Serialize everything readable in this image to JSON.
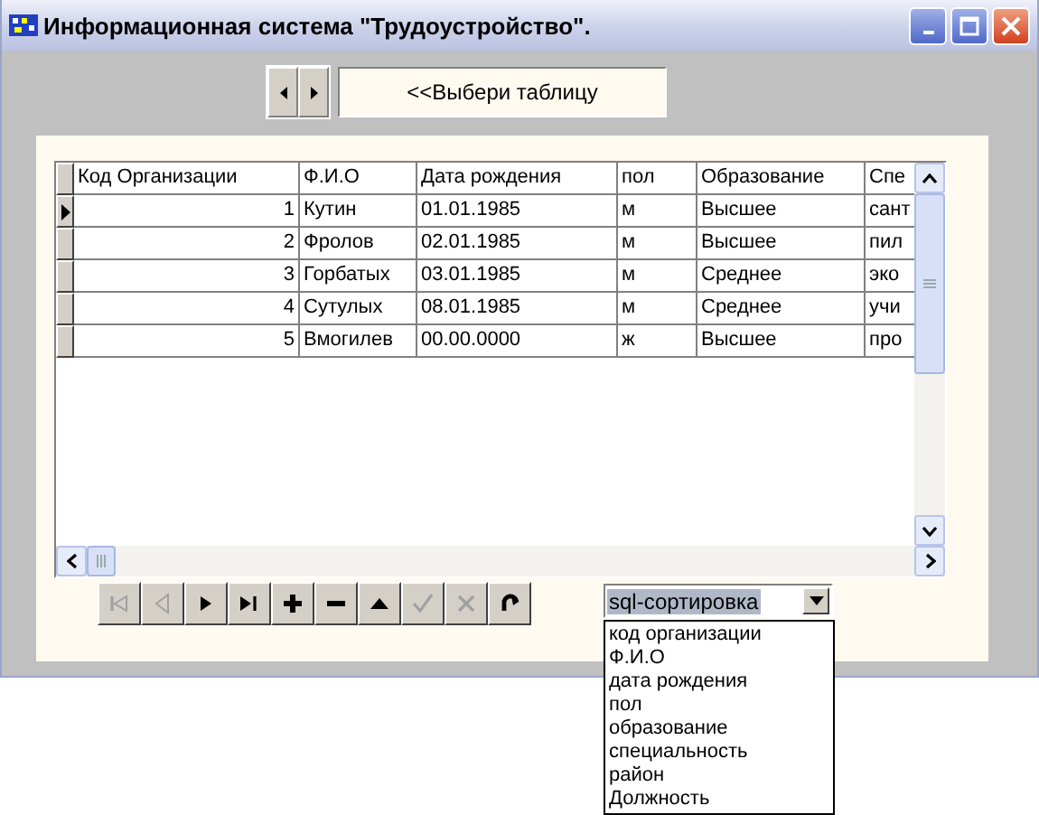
{
  "window": {
    "title": "Информационная система \"Трудоустройство\"."
  },
  "table_picker": {
    "label": "<<Выбери таблицу"
  },
  "table": {
    "columns": [
      "Код Организации",
      "Ф.И.О",
      "Дата рождения",
      "пол",
      "Образование",
      "Спе"
    ],
    "rows": [
      {
        "current": true,
        "cells": [
          "1",
          "Кутин",
          "01.01.1985",
          "м",
          "Высшее",
          "сант"
        ]
      },
      {
        "current": false,
        "cells": [
          "2",
          "Фролов",
          "02.01.1985",
          "м",
          "Высшее",
          "пил"
        ]
      },
      {
        "current": false,
        "cells": [
          "3",
          "Горбатых",
          "03.01.1985",
          "м",
          "Среднее",
          "эко"
        ]
      },
      {
        "current": false,
        "cells": [
          "4",
          "Сутулых",
          "08.01.1985",
          "м",
          "Среднее",
          "учи"
        ]
      },
      {
        "current": false,
        "cells": [
          "5",
          "Вмогилев",
          "00.00.0000",
          "ж",
          "Высшее",
          "про"
        ]
      }
    ]
  },
  "navigator": [
    {
      "kind": "first",
      "disabled": true
    },
    {
      "kind": "prior",
      "disabled": true
    },
    {
      "kind": "next",
      "disabled": false
    },
    {
      "kind": "last",
      "disabled": false
    },
    {
      "kind": "insert",
      "disabled": false
    },
    {
      "kind": "delete",
      "disabled": false
    },
    {
      "kind": "edit",
      "disabled": false
    },
    {
      "kind": "post",
      "disabled": true
    },
    {
      "kind": "cancel",
      "disabled": true
    },
    {
      "kind": "refresh",
      "disabled": false
    }
  ],
  "sort_combo": {
    "value": "sql-сортировка",
    "options": [
      "код организации",
      "Ф.И.О",
      "дата рождения",
      "пол",
      "образование",
      "специальность",
      "район",
      "Должность"
    ]
  }
}
